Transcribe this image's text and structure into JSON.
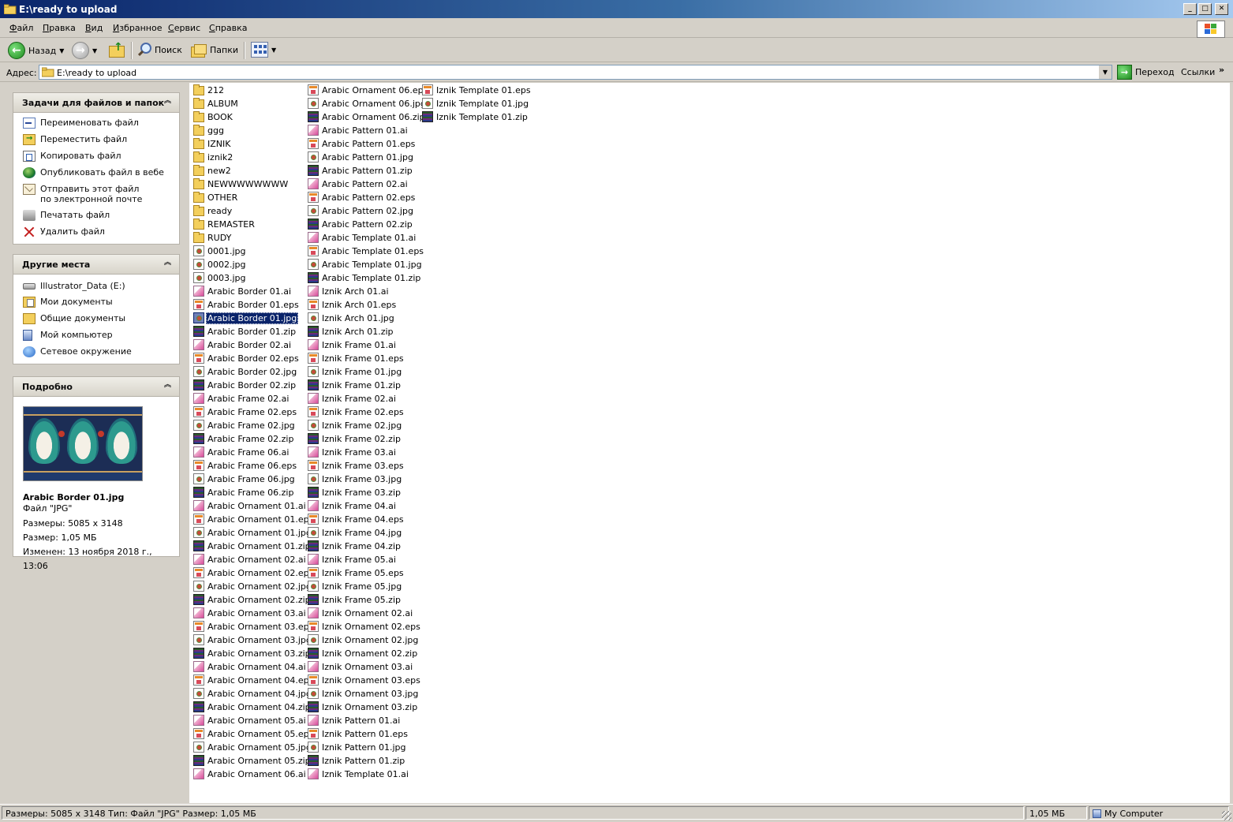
{
  "window": {
    "title": "E:\\ready to upload"
  },
  "menu": [
    "Файл",
    "Правка",
    "Вид",
    "Избранное",
    "Сервис",
    "Справка"
  ],
  "toolbar": {
    "back": "Назад",
    "search": "Поиск",
    "folders": "Папки"
  },
  "address": {
    "label": "Адрес:",
    "value": "E:\\ready to upload",
    "go": "Переход",
    "links": "Ссылки"
  },
  "tasks_panel": {
    "title": "Задачи для файлов и папок",
    "items": [
      "Переименовать файл",
      "Переместить файл",
      "Копировать файл",
      "Опубликовать файл в вебе",
      "Отправить этот файл по электронной почте",
      "Печатать файл",
      "Удалить файл"
    ]
  },
  "places_panel": {
    "title": "Другие места",
    "items": [
      "Illustrator_Data (E:)",
      "Мои документы",
      "Общие документы",
      "Мой компьютер",
      "Сетевое окружение"
    ]
  },
  "details_panel": {
    "title": "Подробно",
    "filename": "Arabic Border 01.jpg",
    "filetype": "Файл \"JPG\"",
    "dimensions": "Размеры: 5085 x 3148",
    "size": "Размер: 1,05 МБ",
    "modified": "Изменен: 13 ноября 2018 г., 13:06"
  },
  "files": {
    "selected": "Arabic Border 01.jpg",
    "columns": [
      [
        {
          "name": "212",
          "type": "folder"
        },
        {
          "name": "ALBUM",
          "type": "folder"
        },
        {
          "name": "BOOK",
          "type": "folder"
        },
        {
          "name": "ggg",
          "type": "folder"
        },
        {
          "name": "IZNIK",
          "type": "folder"
        },
        {
          "name": "iznik2",
          "type": "folder"
        },
        {
          "name": "new2",
          "type": "folder"
        },
        {
          "name": "NEWWWWWWWW",
          "type": "folder"
        },
        {
          "name": "OTHER",
          "type": "folder"
        },
        {
          "name": "ready",
          "type": "folder"
        },
        {
          "name": "REMASTER",
          "type": "folder"
        },
        {
          "name": "RUDY",
          "type": "folder"
        },
        {
          "name": "0001.jpg",
          "type": "jpg"
        },
        {
          "name": "0002.jpg",
          "type": "jpg"
        },
        {
          "name": "0003.jpg",
          "type": "jpg"
        },
        {
          "name": "Arabic Border 01.ai",
          "type": "ai"
        },
        {
          "name": "Arabic Border 01.eps",
          "type": "eps"
        },
        {
          "name": "Arabic Border 01.jpg",
          "type": "jpg"
        },
        {
          "name": "Arabic Border 01.zip",
          "type": "zip"
        },
        {
          "name": "Arabic Border 02.ai",
          "type": "ai"
        },
        {
          "name": "Arabic Border 02.eps",
          "type": "eps"
        },
        {
          "name": "Arabic Border 02.jpg",
          "type": "jpg"
        },
        {
          "name": "Arabic Border 02.zip",
          "type": "zip"
        },
        {
          "name": "Arabic Frame 02.ai",
          "type": "ai"
        },
        {
          "name": "Arabic Frame 02.eps",
          "type": "eps"
        },
        {
          "name": "Arabic Frame 02.jpg",
          "type": "jpg"
        },
        {
          "name": "Arabic Frame 02.zip",
          "type": "zip"
        },
        {
          "name": "Arabic Frame 06.ai",
          "type": "ai"
        },
        {
          "name": "Arabic Frame 06.eps",
          "type": "eps"
        },
        {
          "name": "Arabic Frame 06.jpg",
          "type": "jpg"
        },
        {
          "name": "Arabic Frame 06.zip",
          "type": "zip"
        },
        {
          "name": "Arabic Ornament 01.ai",
          "type": "ai"
        },
        {
          "name": "Arabic Ornament 01.eps",
          "type": "eps"
        },
        {
          "name": "Arabic Ornament 01.jpg",
          "type": "jpg"
        },
        {
          "name": "Arabic Ornament 01.zip",
          "type": "zip"
        },
        {
          "name": "Arabic Ornament 02.ai",
          "type": "ai"
        },
        {
          "name": "Arabic Ornament 02.eps",
          "type": "eps"
        },
        {
          "name": "Arabic Ornament 02.jpg",
          "type": "jpg"
        },
        {
          "name": "Arabic Ornament 02.zip",
          "type": "zip"
        },
        {
          "name": "Arabic Ornament 03.ai",
          "type": "ai"
        },
        {
          "name": "Arabic Ornament 03.eps",
          "type": "eps"
        },
        {
          "name": "Arabic Ornament 03.jpg",
          "type": "jpg"
        },
        {
          "name": "Arabic Ornament 03.zip",
          "type": "zip"
        },
        {
          "name": "Arabic Ornament 04.ai",
          "type": "ai"
        },
        {
          "name": "Arabic Ornament 04.eps",
          "type": "eps"
        },
        {
          "name": "Arabic Ornament 04.jpg",
          "type": "jpg"
        },
        {
          "name": "Arabic Ornament 04.zip",
          "type": "zip"
        },
        {
          "name": "Arabic Ornament 05.ai",
          "type": "ai"
        },
        {
          "name": "Arabic Ornament 05.eps",
          "type": "eps"
        },
        {
          "name": "Arabic Ornament 05.jpg",
          "type": "jpg"
        },
        {
          "name": "Arabic Ornament 05.zip",
          "type": "zip"
        },
        {
          "name": "Arabic Ornament 06.ai",
          "type": "ai"
        }
      ],
      [
        {
          "name": "Arabic Ornament 06.eps",
          "type": "eps"
        },
        {
          "name": "Arabic Ornament 06.jpg",
          "type": "jpg"
        },
        {
          "name": "Arabic Ornament 06.zip",
          "type": "zip"
        },
        {
          "name": "Arabic Pattern 01.ai",
          "type": "ai"
        },
        {
          "name": "Arabic Pattern 01.eps",
          "type": "eps"
        },
        {
          "name": "Arabic Pattern 01.jpg",
          "type": "jpg"
        },
        {
          "name": "Arabic Pattern 01.zip",
          "type": "zip"
        },
        {
          "name": "Arabic Pattern 02.ai",
          "type": "ai"
        },
        {
          "name": "Arabic Pattern 02.eps",
          "type": "eps"
        },
        {
          "name": "Arabic Pattern 02.jpg",
          "type": "jpg"
        },
        {
          "name": "Arabic Pattern 02.zip",
          "type": "zip"
        },
        {
          "name": "Arabic Template 01.ai",
          "type": "ai"
        },
        {
          "name": "Arabic Template 01.eps",
          "type": "eps"
        },
        {
          "name": "Arabic Template 01.jpg",
          "type": "jpg"
        },
        {
          "name": "Arabic Template 01.zip",
          "type": "zip"
        },
        {
          "name": "Iznik Arch 01.ai",
          "type": "ai"
        },
        {
          "name": "Iznik Arch 01.eps",
          "type": "eps"
        },
        {
          "name": "Iznik Arch 01.jpg",
          "type": "jpg"
        },
        {
          "name": "Iznik Arch 01.zip",
          "type": "zip"
        },
        {
          "name": "Iznik Frame 01.ai",
          "type": "ai"
        },
        {
          "name": "Iznik Frame 01.eps",
          "type": "eps"
        },
        {
          "name": "Iznik Frame 01.jpg",
          "type": "jpg"
        },
        {
          "name": "Iznik Frame 01.zip",
          "type": "zip"
        },
        {
          "name": "Iznik Frame 02.ai",
          "type": "ai"
        },
        {
          "name": "Iznik Frame 02.eps",
          "type": "eps"
        },
        {
          "name": "Iznik Frame 02.jpg",
          "type": "jpg"
        },
        {
          "name": "Iznik Frame 02.zip",
          "type": "zip"
        },
        {
          "name": "Iznik Frame 03.ai",
          "type": "ai"
        },
        {
          "name": "Iznik Frame 03.eps",
          "type": "eps"
        },
        {
          "name": "Iznik Frame 03.jpg",
          "type": "jpg"
        },
        {
          "name": "Iznik Frame 03.zip",
          "type": "zip"
        },
        {
          "name": "Iznik Frame 04.ai",
          "type": "ai"
        },
        {
          "name": "Iznik Frame 04.eps",
          "type": "eps"
        },
        {
          "name": "Iznik Frame 04.jpg",
          "type": "jpg"
        },
        {
          "name": "Iznik Frame 04.zip",
          "type": "zip"
        },
        {
          "name": "Iznik Frame 05.ai",
          "type": "ai"
        },
        {
          "name": "Iznik Frame 05.eps",
          "type": "eps"
        },
        {
          "name": "Iznik Frame 05.jpg",
          "type": "jpg"
        },
        {
          "name": "Iznik Frame 05.zip",
          "type": "zip"
        },
        {
          "name": "Iznik Ornament 02.ai",
          "type": "ai"
        },
        {
          "name": "Iznik Ornament 02.eps",
          "type": "eps"
        },
        {
          "name": "Iznik Ornament 02.jpg",
          "type": "jpg"
        },
        {
          "name": "Iznik Ornament 02.zip",
          "type": "zip"
        },
        {
          "name": "Iznik Ornament 03.ai",
          "type": "ai"
        },
        {
          "name": "Iznik Ornament 03.eps",
          "type": "eps"
        },
        {
          "name": "Iznik Ornament 03.jpg",
          "type": "jpg"
        },
        {
          "name": "Iznik Ornament 03.zip",
          "type": "zip"
        },
        {
          "name": "Iznik Pattern 01.ai",
          "type": "ai"
        },
        {
          "name": "Iznik Pattern 01.eps",
          "type": "eps"
        },
        {
          "name": "Iznik Pattern 01.jpg",
          "type": "jpg"
        },
        {
          "name": "Iznik Pattern 01.zip",
          "type": "zip"
        },
        {
          "name": "Iznik Template 01.ai",
          "type": "ai"
        }
      ],
      [
        {
          "name": "Iznik Template 01.eps",
          "type": "eps"
        },
        {
          "name": "Iznik Template 01.jpg",
          "type": "jpg"
        },
        {
          "name": "Iznik Template 01.zip",
          "type": "zip"
        }
      ]
    ]
  },
  "statusbar": {
    "info": "Размеры: 5085 x 3148 Тип: Файл \"JPG\" Размер: 1,05 МБ",
    "size": "1,05 МБ",
    "zone": "My Computer"
  },
  "colors": {
    "selection": "#0a246a",
    "titlebar_start": "#0a246a",
    "titlebar_end": "#a6caf0",
    "chrome": "#d4d0c8"
  }
}
